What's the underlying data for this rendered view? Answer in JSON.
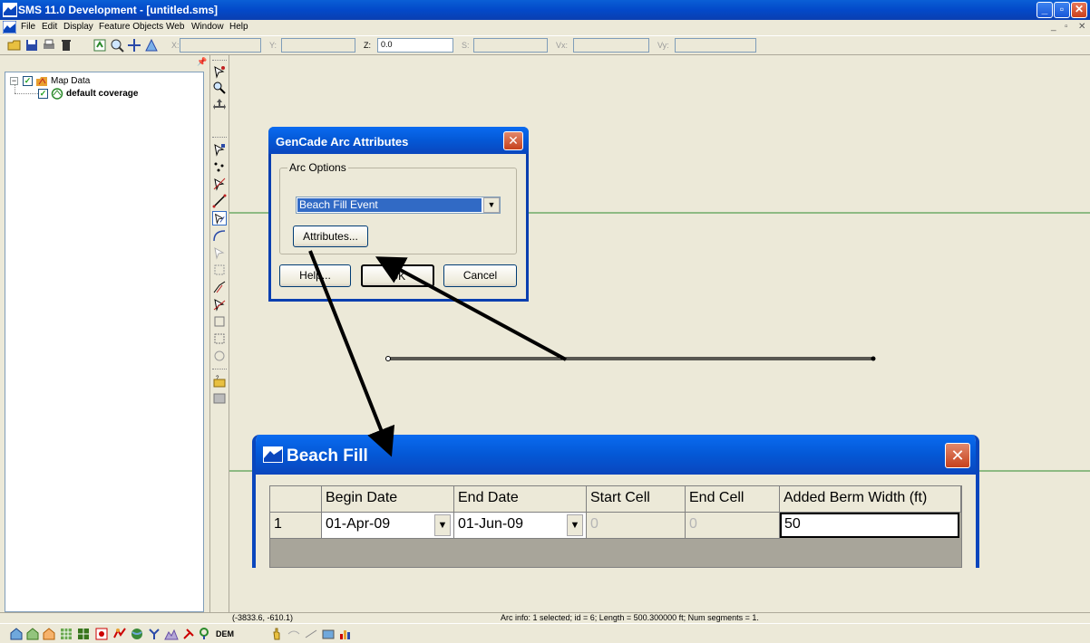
{
  "window": {
    "title": "SMS 11.0 Development - [untitled.sms]",
    "min": "_",
    "max": "▫",
    "close": "✕"
  },
  "menu": {
    "items": [
      "File",
      "Edit",
      "Display",
      "Feature Objects",
      "Web",
      "Window",
      "Help"
    ],
    "mdi": [
      "_",
      "▫",
      "✕"
    ]
  },
  "toolbar": {
    "coords": [
      {
        "label": "X:",
        "value": ""
      },
      {
        "label": "Y:",
        "value": ""
      },
      {
        "label": "Z:",
        "value": "0.0"
      },
      {
        "label": "S:",
        "value": ""
      },
      {
        "label": "Vx:",
        "value": ""
      },
      {
        "label": "Vy:",
        "value": ""
      }
    ]
  },
  "tree": {
    "root": {
      "label": "Map Data",
      "expander": "−",
      "checked": "✓"
    },
    "child": {
      "label": "default coverage",
      "checked": "✓"
    }
  },
  "dialog_arc": {
    "title": "GenCade Arc Attributes",
    "close": "✕",
    "group_label": "Arc Options",
    "selected_option": "Beach Fill Event",
    "attributes_button": "Attributes...",
    "help_button": "Help...",
    "ok_button": "OK",
    "cancel_button": "Cancel"
  },
  "dialog_fill": {
    "title": "Beach Fill",
    "close": "✕",
    "columns": [
      "",
      "Begin Date",
      "End Date",
      "Start Cell",
      "End Cell",
      "Added Berm Width (ft)"
    ],
    "rows": [
      {
        "index": "1",
        "begin": "01-Apr-09",
        "end": "01-Jun-09",
        "start_cell": "0",
        "end_cell": "0",
        "berm": "50"
      }
    ]
  },
  "status": {
    "coords": "(-3833.6, -610.1)",
    "arc_info": "Arc info: 1 selected; id = 6; Length = 500.300000 ft; Num segments = 1."
  },
  "bottombar": {
    "dem_label": "DEM"
  },
  "colors": {
    "titlebar": "#0458d6",
    "selection": "#316ac5",
    "guide_line": "#2e8b2e"
  }
}
